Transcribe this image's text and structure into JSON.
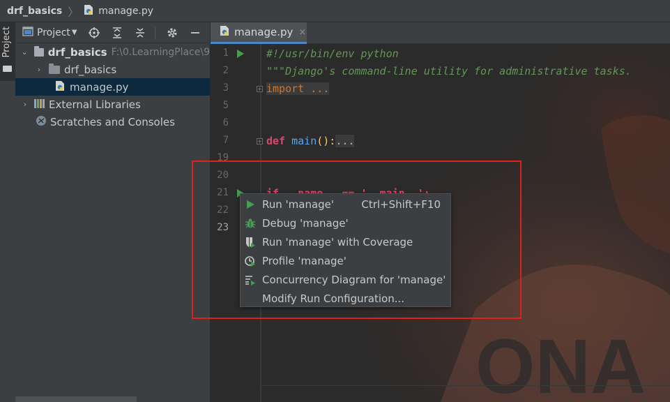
{
  "breadcrumb": {
    "project": "drf_basics",
    "file": "manage.py"
  },
  "left_strip": {
    "project_tab": "Project"
  },
  "project_panel": {
    "title": "Project",
    "tree": [
      {
        "label": "drf_basics",
        "path": "F:\\0.LearningPlace\\9"
      },
      {
        "label": "drf_basics"
      },
      {
        "label": "manage.py"
      },
      {
        "label": "External Libraries"
      },
      {
        "label": "Scratches and Consoles"
      }
    ]
  },
  "tabs": [
    {
      "label": "manage.py",
      "close": "×"
    }
  ],
  "editor": {
    "line_numbers": [
      "1",
      "2",
      "3",
      "5",
      "6",
      "7",
      "19",
      "20",
      "21",
      "22",
      "23"
    ],
    "code": {
      "l1": "#!/usr/bin/env python",
      "l2": "\"\"\"Django's command-line utility for administrative tasks.",
      "l3": "import ...",
      "l7_kw": "def",
      "l7_fn": "main",
      "l7_rest": "():",
      "l7_dots": "...",
      "l21": "if __name__ == '__main__':"
    }
  },
  "context_menu": {
    "items": [
      {
        "label": "Run 'manage'",
        "shortcut": "Ctrl+Shift+F10"
      },
      {
        "label": "Debug 'manage'"
      },
      {
        "label": "Run 'manage' with Coverage"
      },
      {
        "label": "Profile 'manage'"
      },
      {
        "label": "Concurrency Diagram for 'manage'"
      },
      {
        "label": "Modify Run Configuration..."
      }
    ]
  },
  "colors": {
    "highlight": "#e0201b",
    "run_green": "#499c54",
    "selection": "#0d293e"
  }
}
